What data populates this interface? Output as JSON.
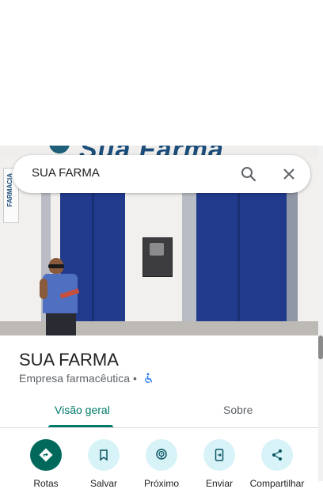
{
  "search": {
    "query": "SUA FARMA"
  },
  "photo": {
    "sign_text": "Sua Farma",
    "side_sign": "FARMÁCIA"
  },
  "place": {
    "name": "SUA FARMA",
    "category": "Empresa farmacêutica",
    "separator": "•"
  },
  "tabs": [
    {
      "label": "Visão geral",
      "selected": true
    },
    {
      "label": "Sobre",
      "selected": false
    }
  ],
  "actions": [
    {
      "label": "Rotas",
      "icon": "directions-icon",
      "primary": true
    },
    {
      "label": "Salvar",
      "icon": "bookmark-icon",
      "primary": false
    },
    {
      "label": "Próximo",
      "icon": "nearby-icon",
      "primary": false
    },
    {
      "label": "Enviar",
      "icon": "send-to-phone-icon",
      "primary": false
    },
    {
      "label": "Compartilhar",
      "icon": "share-icon",
      "primary": false
    }
  ],
  "colors": {
    "accent": "#00796b",
    "primary_action_bg": "#00695c",
    "secondary_action_bg": "#d7f3f7",
    "accessibility": "#1a73e8"
  }
}
